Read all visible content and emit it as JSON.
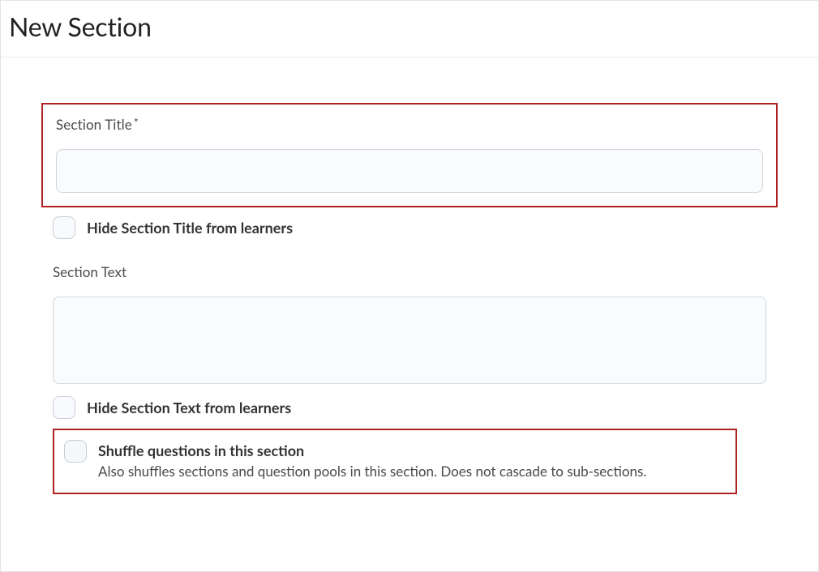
{
  "header": {
    "title": "New Section"
  },
  "form": {
    "sectionTitle": {
      "label": "Section Title",
      "value": ""
    },
    "hideTitle": {
      "label": "Hide Section Title from learners",
      "checked": false
    },
    "sectionText": {
      "label": "Section Text",
      "value": ""
    },
    "hideText": {
      "label": "Hide Section Text from learners",
      "checked": false
    },
    "shuffle": {
      "label": "Shuffle questions in this section",
      "helper": "Also shuffles sections and question pools in this section. Does not cascade to sub-sections.",
      "checked": false
    }
  }
}
